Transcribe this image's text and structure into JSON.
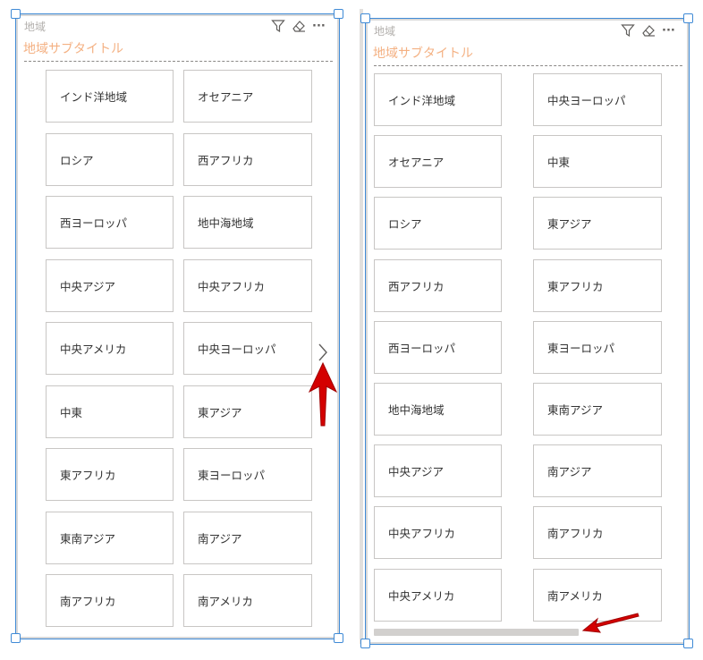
{
  "left_panel": {
    "title": "地域",
    "subtitle": "地域サブタイトル",
    "icons": [
      "filter-icon",
      "eraser-icon",
      "more-options-icon"
    ],
    "more_label": "···",
    "tiles": [
      "インド洋地域",
      "オセアニア",
      "ロシア",
      "西アフリカ",
      "西ヨーロッパ",
      "地中海地域",
      "中央アジア",
      "中央アフリカ",
      "中央アメリカ",
      "中央ヨーロッパ",
      "中東",
      "東アジア",
      "東アフリカ",
      "東ヨーロッパ",
      "東南アジア",
      "南アジア",
      "南アフリカ",
      "南アメリカ"
    ],
    "next_page_icon": "chevron-right-icon",
    "arrow_color": "#e00000"
  },
  "right_panel": {
    "title": "地域",
    "subtitle": "地域サブタイトル",
    "icons": [
      "filter-icon",
      "eraser-icon",
      "more-options-icon"
    ],
    "more_label": "···",
    "tiles": [
      "インド洋地域",
      "中央ヨーロッパ",
      "オセアニア",
      "中東",
      "ロシア",
      "東アジア",
      "西アフリカ",
      "東アフリカ",
      "西ヨーロッパ",
      "東ヨーロッパ",
      "地中海地域",
      "東南アジア",
      "中央アジア",
      "南アジア",
      "中央アフリカ",
      "南アフリカ",
      "中央アメリカ",
      "南アメリカ"
    ],
    "scroll_position": 0,
    "arrow_color": "#e00000"
  }
}
